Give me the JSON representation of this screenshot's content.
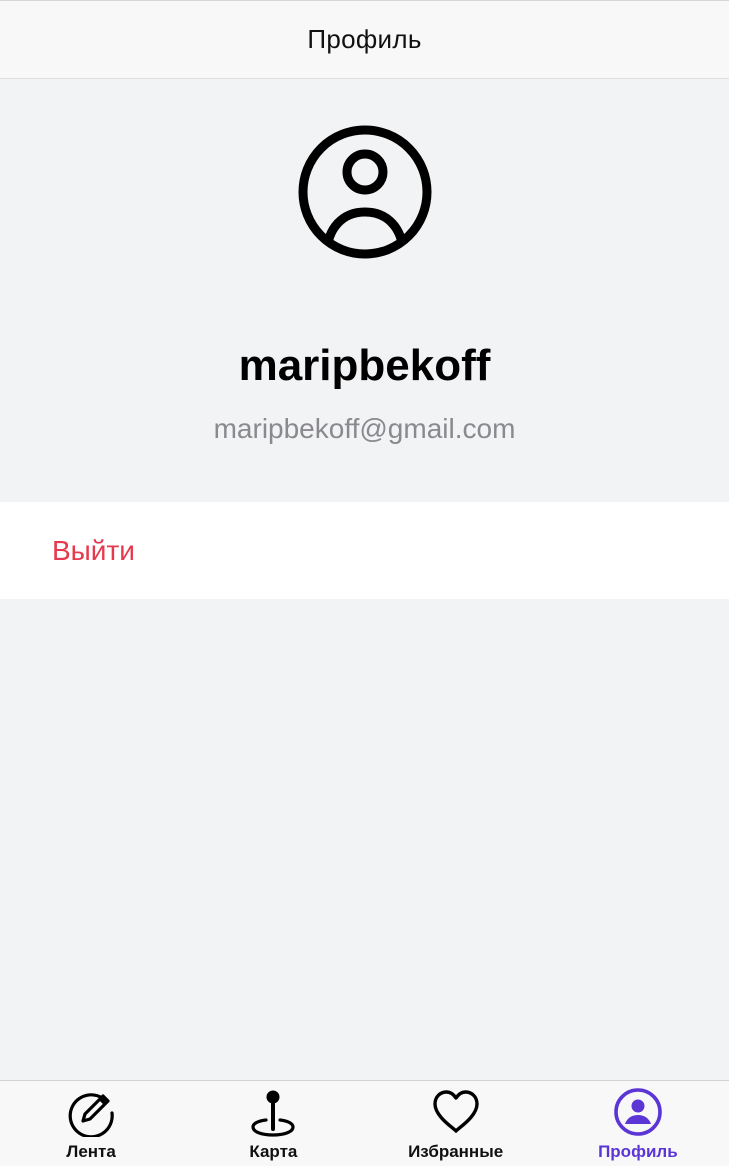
{
  "header": {
    "title": "Профиль"
  },
  "profile": {
    "avatar_icon": "user-circle-icon",
    "username": "maripbekoff",
    "email": "maripbekoff@gmail.com"
  },
  "actions": {
    "logout_label": "Выйти",
    "logout_color": "#e5394d"
  },
  "tab_bar": {
    "active_color": "#5b35d5",
    "tabs": [
      {
        "label": "Лента",
        "icon": "edit-circle-icon",
        "active": false
      },
      {
        "label": "Карта",
        "icon": "map-pin-icon",
        "active": false
      },
      {
        "label": "Избранные",
        "icon": "heart-icon",
        "active": false
      },
      {
        "label": "Профиль",
        "icon": "user-circle-icon",
        "active": true
      }
    ]
  }
}
